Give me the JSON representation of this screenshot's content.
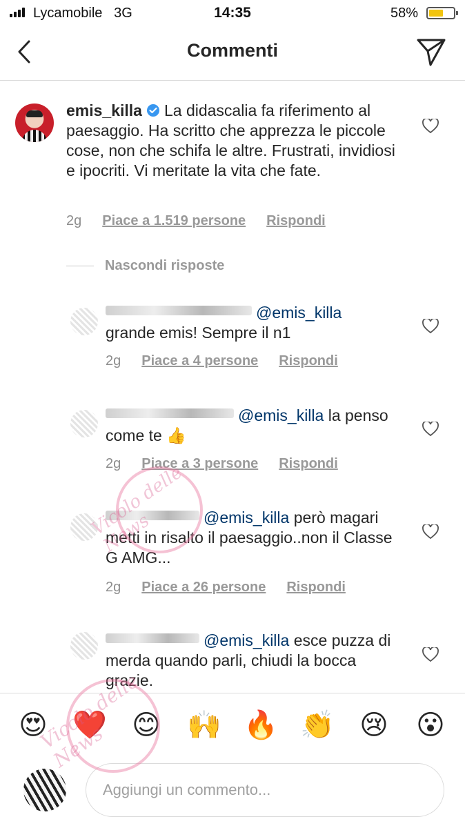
{
  "status_bar": {
    "carrier": "Lycamobile",
    "network": "3G",
    "time": "14:35",
    "battery_percent": "58%",
    "battery_level": 0.58,
    "accent_color": "#f1c40f"
  },
  "nav": {
    "title": "Commenti"
  },
  "main_comment": {
    "username": "emis_killa",
    "verified": true,
    "text": "La didascalia fa riferimento al paesaggio. Ha scritto che apprezza le piccole cose, non che schifa le altre. Frustrati, invidiosi e ipocriti. Vi meritate la vita che fate.",
    "time": "2g",
    "likes": "Piace a 1.519 persone",
    "reply_label": "Rispondi"
  },
  "hide_replies_label": "Nascondi risposte",
  "replies": [
    {
      "mention": "@emis_killa",
      "text": "grande emis! Sempre il n1",
      "time": "2g",
      "likes": "Piace a 4 persone",
      "reply_label": "Rispondi"
    },
    {
      "mention": "@emis_killa",
      "text": "la penso come te 👍",
      "time": "2g",
      "likes": "Piace a 3 persone",
      "reply_label": "Rispondi"
    },
    {
      "mention": "@emis_killa",
      "text": "però magari metti in risalto il paesaggio..non il Classe G AMG...",
      "time": "2g",
      "likes": "Piace a 26 persone",
      "reply_label": "Rispondi"
    },
    {
      "mention": "@emis_killa",
      "text": "esce puzza di merda quando parli, chiudi la bocca grazie."
    }
  ],
  "emoji_bar": [
    "😍",
    "❤️",
    "😊",
    "🙌",
    "🔥",
    "👏",
    "😢",
    "😮"
  ],
  "composer": {
    "placeholder": "Aggiungi un commento..."
  },
  "watermark": {
    "text": "Vicolo delle News"
  }
}
